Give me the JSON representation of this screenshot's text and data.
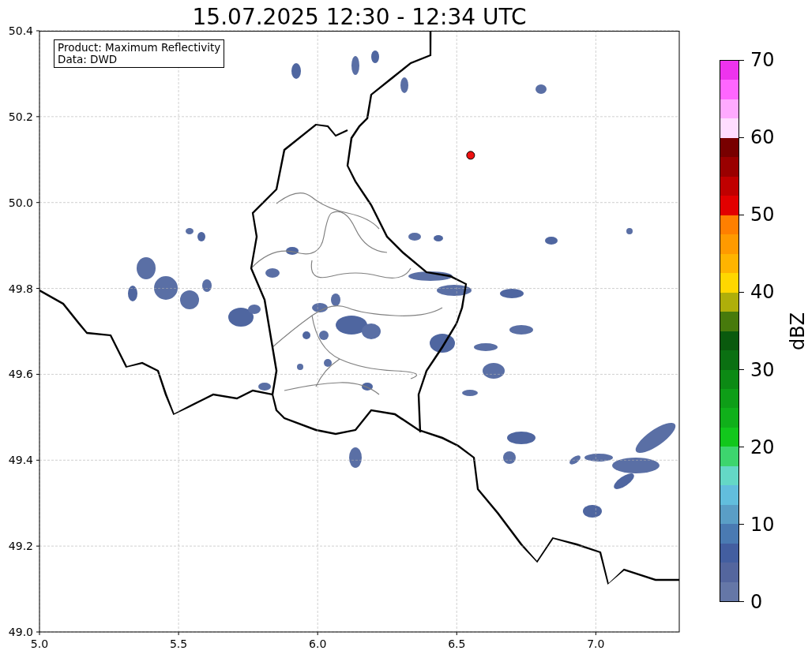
{
  "title": "15.07.2025 12:30 - 12:34 UTC",
  "annotation": {
    "lines": [
      "Product: Maximum Reflectivity",
      "Data: DWD"
    ]
  },
  "chart_data": {
    "type": "scatter",
    "xlim": [
      5.0,
      7.3
    ],
    "ylim": [
      49.0,
      50.4
    ],
    "xticks": [
      {
        "value": 5.0,
        "label": "5.0"
      },
      {
        "value": 5.5,
        "label": "5.5"
      },
      {
        "value": 6.0,
        "label": "6.0"
      },
      {
        "value": 6.5,
        "label": "6.5"
      },
      {
        "value": 7.0,
        "label": "7.0"
      }
    ],
    "yticks": [
      {
        "value": 49.0,
        "label": "49.0"
      },
      {
        "value": 49.2,
        "label": "49.2"
      },
      {
        "value": 49.4,
        "label": "49.4"
      },
      {
        "value": 49.6,
        "label": "49.6"
      },
      {
        "value": 49.8,
        "label": "49.8"
      },
      {
        "value": 50.0,
        "label": "50.0"
      },
      {
        "value": 50.2,
        "label": "50.2"
      },
      {
        "value": 50.4,
        "label": "50.4"
      }
    ],
    "grid": true,
    "series": [
      {
        "color": "#ee1111",
        "x": [
          6.55
        ],
        "values": [
          50.11
        ]
      }
    ]
  },
  "colorbar": {
    "label": "dBZ",
    "ticks": [
      "70",
      "60",
      "50",
      "40",
      "30",
      "20",
      "10",
      "0"
    ],
    "steps": [
      {
        "color": "#ee33ee"
      },
      {
        "color": "#ff66ff"
      },
      {
        "color": "#ffaaff"
      },
      {
        "color": "#ffddff"
      },
      {
        "color": "#780000"
      },
      {
        "color": "#9a0000"
      },
      {
        "color": "#c00000"
      },
      {
        "color": "#e20000"
      },
      {
        "color": "#ff7f00"
      },
      {
        "color": "#ff9a00"
      },
      {
        "color": "#ffb400"
      },
      {
        "color": "#ffd700"
      },
      {
        "color": "#afaf0a"
      },
      {
        "color": "#477a0c"
      },
      {
        "color": "#0a5a0e"
      },
      {
        "color": "#0b7012"
      },
      {
        "color": "#0c8a14"
      },
      {
        "color": "#0e9e17"
      },
      {
        "color": "#10b01a"
      },
      {
        "color": "#12c71c"
      },
      {
        "color": "#3dd56e"
      },
      {
        "color": "#64d8c6"
      },
      {
        "color": "#62bedd"
      },
      {
        "color": "#5a9ec6"
      },
      {
        "color": "#4a7ab2"
      },
      {
        "color": "#435ea0"
      },
      {
        "color": "#54669e"
      },
      {
        "color": "#6577a7"
      }
    ]
  }
}
